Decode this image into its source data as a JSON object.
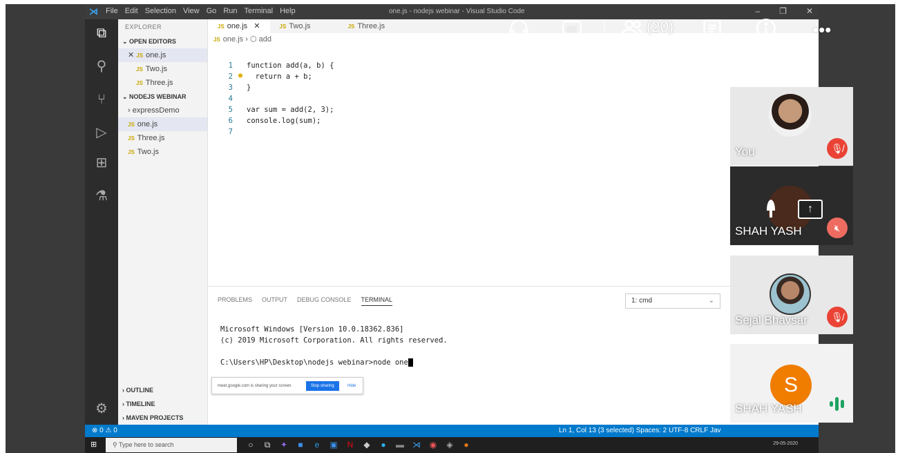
{
  "window": {
    "title": "one.js - nodejs webinar - Visual Studio Code",
    "menu": [
      "File",
      "Edit",
      "Selection",
      "View",
      "Go",
      "Run",
      "Terminal",
      "Help"
    ],
    "controls": [
      "–",
      "❐",
      "✕"
    ]
  },
  "activity_icons": [
    "files-icon",
    "search-icon",
    "source-control-icon",
    "run-debug-icon",
    "extensions-icon",
    "testing-icon",
    "settings-gear-icon"
  ],
  "sidebar": {
    "title": "EXPLORER",
    "open_editors_label": "OPEN EDITORS",
    "open_editors": [
      {
        "prefix": "✕",
        "name": "one.js"
      },
      {
        "prefix": "",
        "name": "Two.js"
      },
      {
        "prefix": "",
        "name": "Three.js"
      }
    ],
    "folder_label": "NODEJS WEBINAR",
    "folder_items": [
      {
        "name": "expressDemo",
        "is_folder": true
      },
      {
        "name": "one.js",
        "is_folder": false
      },
      {
        "name": "Three.js",
        "is_folder": false
      },
      {
        "name": "Two.js",
        "is_folder": false
      }
    ],
    "bottom_sections": [
      "OUTLINE",
      "TIMELINE",
      "MAVEN PROJECTS"
    ]
  },
  "tabs": [
    {
      "label": "one.js",
      "active": true,
      "close": "✕"
    },
    {
      "label": "Two.js",
      "active": false
    },
    {
      "label": "Three.js",
      "active": false
    }
  ],
  "breadcrumb": {
    "file": "one.js",
    "symbol": "add"
  },
  "code_lines": [
    "function add(a, b) {",
    "  return a + b;",
    "}",
    "",
    "var sum = add(2, 3);",
    "console.log(sum);",
    ""
  ],
  "panel": {
    "tabs": [
      "PROBLEMS",
      "OUTPUT",
      "DEBUG CONSOLE",
      "TERMINAL"
    ],
    "active_tab": "TERMINAL",
    "terminal_select": "1: cmd",
    "terminal_lines": [
      "Microsoft Windows [Version 10.0.18362.836]",
      "(c) 2019 Microsoft Corporation. All rights reserved.",
      "",
      "C:\\Users\\HP\\Desktop\\nodejs webinar>node one"
    ]
  },
  "share_bar": {
    "message": "meet.google.com is sharing your screen.",
    "stop_label": "Stop sharing",
    "hide_label": "Hide"
  },
  "status_bar": {
    "left": "⊗ 0 ⚠ 0",
    "right": "Ln 1, Col 13 (3 selected)   Spaces: 2   UTF-8   CRLF   Jav"
  },
  "taskbar": {
    "search_placeholder": "Type here to search",
    "date": "29-05-2020"
  },
  "meet": {
    "participants_count": "(20)",
    "tiles": [
      {
        "name": "You",
        "muted": true,
        "kind": "photo",
        "bg": "#e8e8e8"
      },
      {
        "name": "SHAH YASH",
        "muted": true,
        "kind": "presenting",
        "bg": "#2b2b2b"
      },
      {
        "name": "Sejal Bhavsar",
        "muted": true,
        "kind": "photo2",
        "bg": "#e8e8e8"
      },
      {
        "name": "SHAH YASH",
        "muted": false,
        "kind": "letter",
        "letter": "S",
        "bg": "#f2f2f2"
      }
    ]
  }
}
